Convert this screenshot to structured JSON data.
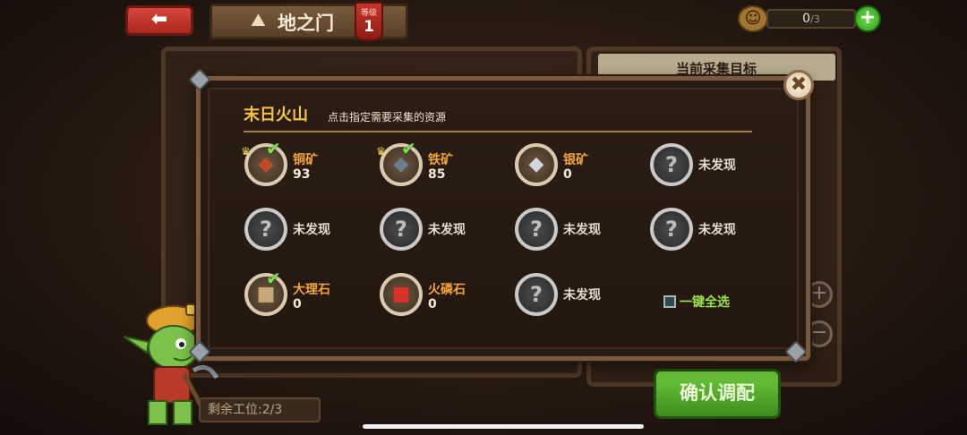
{
  "header": {
    "back_label": "⬅",
    "title": "地之门",
    "level_label": "等级",
    "level_value": "1",
    "counter_current": "0",
    "counter_max": "/3",
    "counter_plus": "+"
  },
  "background": {
    "right_panel_label": "当前采集目标",
    "slots_label": "剩余工位:",
    "slots_value": "2/3",
    "confirm_label": "确认调配",
    "plus": "+",
    "minus": "−"
  },
  "dialog": {
    "title": "末日火山",
    "subtitle": "点击指定需要采集的资源",
    "close_label": "✖",
    "select_all_label": "一键全选",
    "select_all_checked": false,
    "resources": [
      {
        "name": "铜矿",
        "count": "93",
        "discovered": true,
        "selected": true,
        "glyph": "◆",
        "color": "#c24a2a"
      },
      {
        "name": "铁矿",
        "count": "85",
        "discovered": true,
        "selected": true,
        "glyph": "◆",
        "color": "#6b7d8f"
      },
      {
        "name": "银矿",
        "count": "0",
        "discovered": true,
        "selected": false,
        "glyph": "◆",
        "color": "#cfd6dd"
      },
      {
        "name": "未发现",
        "discovered": false,
        "glyph": "?"
      },
      {
        "name": "未发现",
        "discovered": false,
        "glyph": "?"
      },
      {
        "name": "未发现",
        "discovered": false,
        "glyph": "?"
      },
      {
        "name": "未发现",
        "discovered": false,
        "glyph": "?"
      },
      {
        "name": "未发现",
        "discovered": false,
        "glyph": "?"
      },
      {
        "name": "大理石",
        "count": "0",
        "discovered": true,
        "selected": true,
        "glyph": "■",
        "color": "#c9a878"
      },
      {
        "name": "火磷石",
        "count": "0",
        "discovered": true,
        "selected": false,
        "glyph": "■",
        "color": "#d8322a"
      },
      {
        "name": "未发现",
        "discovered": false,
        "glyph": "?"
      }
    ]
  }
}
